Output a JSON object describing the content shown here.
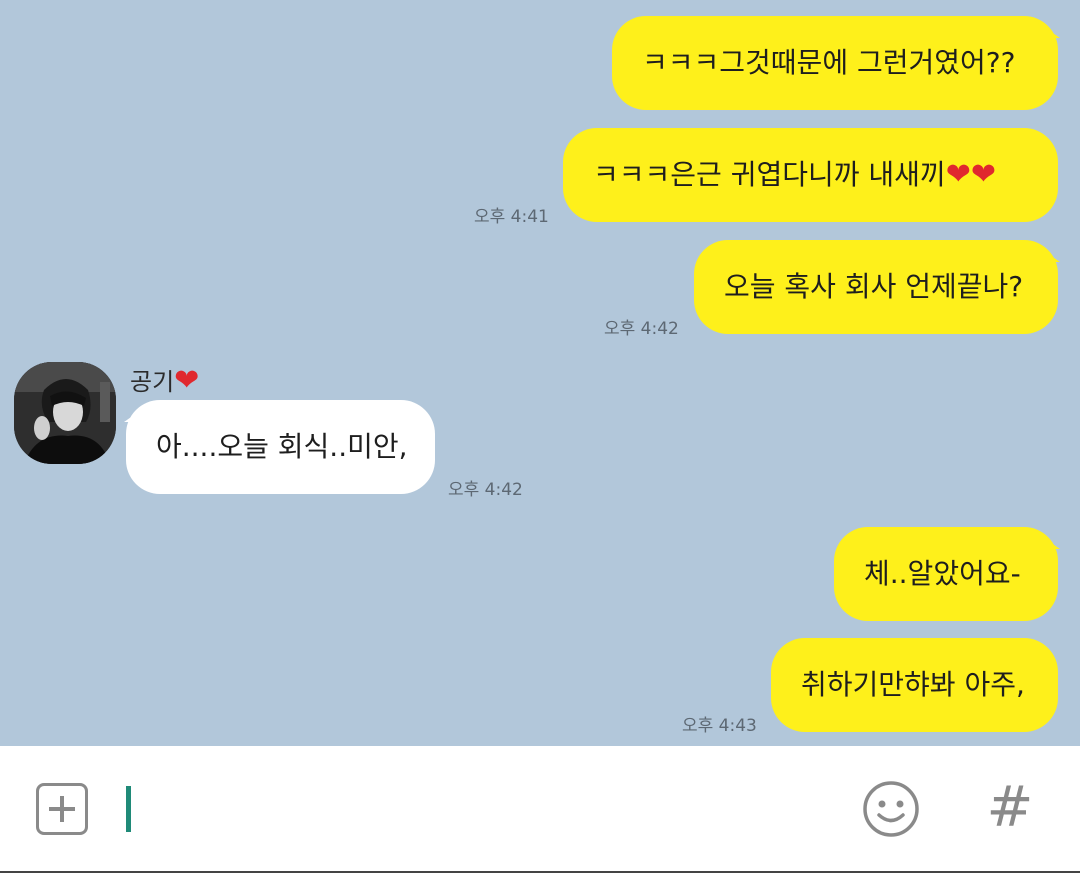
{
  "messages": [
    {
      "dir": "out",
      "text": "ㅋㅋㅋ그것때문에 그런거였어??",
      "time": ""
    },
    {
      "dir": "out",
      "text": "ㅋㅋㅋ은근 귀엽다니까 내새끼",
      "hearts": "❤❤",
      "time": "오후 4:41"
    },
    {
      "dir": "out",
      "text": "오늘 혹사 회사 언제끝나?",
      "time": "오후 4:42"
    },
    {
      "dir": "in",
      "sender": "공기",
      "sender_heart": "❤",
      "text": "아....오늘 회식..미안,",
      "time": "오후 4:42"
    },
    {
      "dir": "out",
      "text": "체..알았어요-",
      "time": ""
    },
    {
      "dir": "out",
      "text": "취하기만햐봐 아주,",
      "time": "오후 4:43"
    }
  ],
  "input": {
    "value": "",
    "plus_icon": "plus-square-icon",
    "emoji_icon": "smiley-icon",
    "hash_label": "#"
  },
  "colors": {
    "background": "#b2c7da",
    "outgoing_bubble": "#fef01b",
    "incoming_bubble": "#ffffff",
    "caret": "#1f8a78",
    "heart": "#e0282e"
  }
}
